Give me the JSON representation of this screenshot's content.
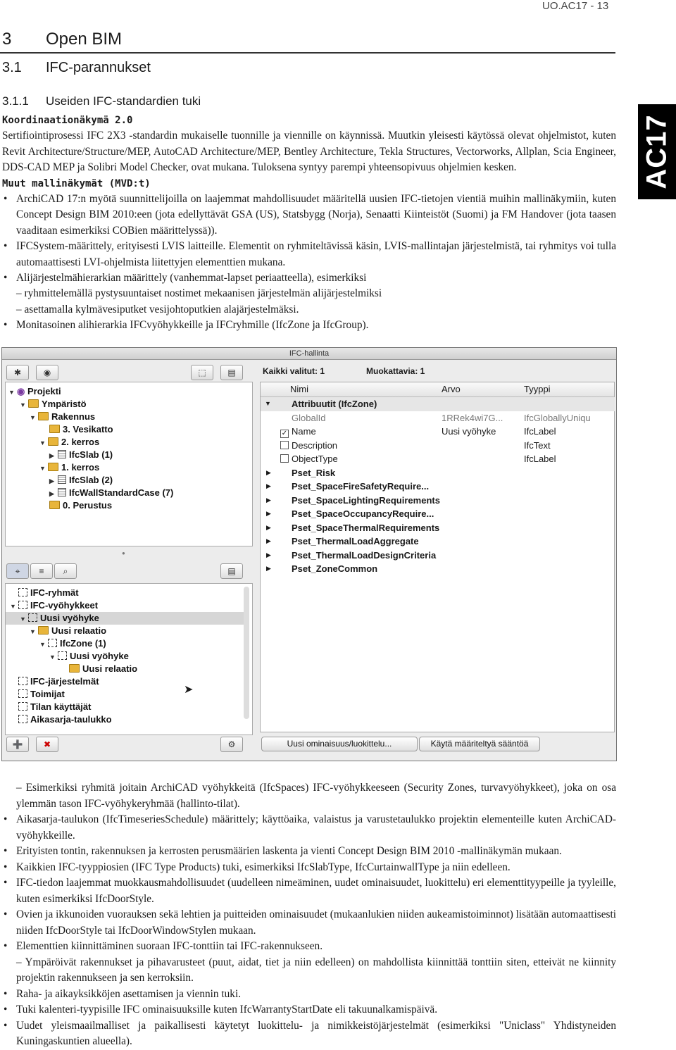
{
  "header": {
    "code": "UO.AC17 - 13",
    "side_tab": "AC17"
  },
  "headings": {
    "h1_num": "3",
    "h1_text": "Open BIM",
    "h2_num": "3.1",
    "h2_text": "IFC-parannukset",
    "h3_num": "3.1.1",
    "h3_text": "Useiden IFC-standardien tuki"
  },
  "section1": {
    "title": "Koordinaationäkymä 2.0",
    "para": "Sertifiointiprosessi IFC 2X3 -standardin mukaiselle tuonnille ja viennille on käynnissä. Muutkin yleisesti käytössä olevat ohjelmistot, kuten Revit Architecture/Structure/MEP, AutoCAD Architecture/MEP, Bentley Architecture, Tekla Structures, Vectorworks, Allplan, Scia Engineer, DDS-CAD MEP ja Solibri Model Checker, ovat mukana. Tuloksena syntyy parempi yhteensopivuus ohjelmien kesken."
  },
  "section2": {
    "title": "Muut mallinäkymät (MVD:t)",
    "b1": "ArchiCAD 17:n myötä suunnittelijoilla on laajemmat mahdollisuudet määritellä uusien IFC-tietojen vientiä muihin mallinäkymiin, kuten Concept Design BIM 2010:een (jota edellyttävät GSA (US), Statsbygg (Norja), Senaatti Kiinteistöt (Suomi) ja FM Handover (jota taasen vaaditaan esimerkiksi COBien määrittelyssä)).",
    "b2": "IFCSystem-määrittely, erityisesti LVIS laitteille. Elementit on ryhmiteltävissä käsin, LVIS-mallintajan järjestelmistä, tai ryhmitys voi tulla automaattisesti LVI-ohjelmista liitettyjen elementtien mukana.",
    "b3": "Alijärjestelmähierarkian määrittely (vanhemmat-lapset periaatteella), esimerkiksi",
    "b3_sub1": "– ryhmittelemällä pystysuuntaiset nostimet mekaanisen järjestelmän alijärjestelmiksi",
    "b3_sub2": "– asettamalla kylmävesiputket vesijohtoputkien alajärjestelmäksi.",
    "b4": "Monitasoinen alihierarkia IFCvyöhykkeille ja IFCryhmille (IfcZone ja IfcGroup)."
  },
  "dialog": {
    "title": "IFC-hallinta",
    "kaikki": "Kaikki valitut: 1",
    "muokattavia": "Muokattavia: 1",
    "tree_top": [
      {
        "label": "Projekti"
      },
      {
        "label": "Ympäristö"
      },
      {
        "label": "Rakennus"
      },
      {
        "label": "3. Vesikatto"
      },
      {
        "label": "2. kerros"
      },
      {
        "label": "IfcSlab (1)"
      },
      {
        "label": "1. kerros"
      },
      {
        "label": "IfcSlab (2)"
      },
      {
        "label": "IfcWallStandardCase (7)"
      },
      {
        "label": "0. Perustus"
      }
    ],
    "tree_bottom": [
      {
        "label": "IFC-ryhmät"
      },
      {
        "label": "IFC-vyöhykkeet"
      },
      {
        "label": "Uusi vyöhyke"
      },
      {
        "label": "Uusi relaatio"
      },
      {
        "label": "IfcZone (1)"
      },
      {
        "label": "Uusi vyöhyke"
      },
      {
        "label": "Uusi relaatio"
      },
      {
        "label": "IFC-järjestelmät"
      },
      {
        "label": "Toimijat"
      },
      {
        "label": "Tilan käyttäjät"
      },
      {
        "label": "Aikasarja-taulukko"
      }
    ],
    "col_nimi": "Nimi",
    "col_arvo": "Arvo",
    "col_tyyppi": "Tyyppi",
    "rows": [
      {
        "name": "Attribuutit (IfcZone)",
        "value": "",
        "type": ""
      },
      {
        "name": "GlobalId",
        "value": "1RRek4wi7G...",
        "type": "IfcGloballyUniqu"
      },
      {
        "name": "Name",
        "value": "Uusi vyöhyke",
        "type": "IfcLabel"
      },
      {
        "name": "Description",
        "value": "",
        "type": "IfcText"
      },
      {
        "name": "ObjectType",
        "value": "",
        "type": "IfcLabel"
      },
      {
        "name": "Pset_Risk",
        "value": "",
        "type": ""
      },
      {
        "name": "Pset_SpaceFireSafetyRequire...",
        "value": "",
        "type": ""
      },
      {
        "name": "Pset_SpaceLightingRequirements",
        "value": "",
        "type": ""
      },
      {
        "name": "Pset_SpaceOccupancyRequire...",
        "value": "",
        "type": ""
      },
      {
        "name": "Pset_SpaceThermalRequirements",
        "value": "",
        "type": ""
      },
      {
        "name": "Pset_ThermalLoadAggregate",
        "value": "",
        "type": ""
      },
      {
        "name": "Pset_ThermalLoadDesignCriteria",
        "value": "",
        "type": ""
      },
      {
        "name": "Pset_ZoneCommon",
        "value": "",
        "type": ""
      }
    ],
    "btn_new_prop": "Uusi ominaisuus/luokittelu...",
    "btn_apply": "Käytä määriteltyä sääntöä"
  },
  "lower": {
    "dash1": "– Esimerkiksi ryhmitä joitain ArchiCAD vyöhykkeitä (IfcSpaces) IFC-vyöhykkeeseen (Security Zones, turvavyöhykkeet), joka on osa ylemmän tason IFC-vyöhykeryhmää (hallinto-tilat).",
    "l1": "Aikasarja-taulukon (IfcTimeseriesSchedule) määrittely; käyttöaika, valaistus ja varustetaulukko projektin elementeille kuten ArchiCAD-vyöhykkeille.",
    "l2": "Erityisten tontin, rakennuksen ja kerrosten perusmäärien laskenta ja vienti Concept Design BIM 2010 -mallinäkymän mukaan.",
    "l3": "Kaikkien IFC-tyyppiosien (IFC Type Products) tuki, esimerkiksi IfcSlabType, IfcCurtainwallType ja niin edelleen.",
    "l4": "IFC-tiedon laajemmat muokkausmahdollisuudet (uudelleen nimeäminen, uudet ominaisuudet, luokittelu) eri elementtityypeille ja tyyleille, kuten esimerkiksi IfcDoorStyle.",
    "l5": "Ovien ja ikkunoiden vuorauksen sekä lehtien ja puitteiden ominaisuudet (mukaanlukien niiden aukeamistoiminnot) lisätään automaattisesti niiden IfcDoorStyle tai IfcDoorWindowStylen mukaan.",
    "l6": "Elementtien kiinnittäminen suoraan IFC-tonttiin tai IFC-rakennukseen.",
    "l6_sub": "– Ympäröivät rakennukset ja pihavarusteet (puut, aidat, tiet ja niin edelleen) on mahdollista kiinnittää tonttiin siten, etteivät ne kiinnity projektin rakennukseen ja sen kerroksiin.",
    "l7": "Raha- ja aikayksikköjen asettamisen ja viennin tuki.",
    "l8": "Tuki kalenteri-tyypisille IFC ominaisuuksille kuten IfcWarrantyStartDate eli takuunalkamispäivä.",
    "l9": "Uudet yleismaailmalliset ja paikallisesti käytetyt luokittelu- ja nimikkeistöjärjestelmät (esimerkiksi \"Uniclass\" Yhdistyneiden Kuningaskuntien alueella)."
  }
}
